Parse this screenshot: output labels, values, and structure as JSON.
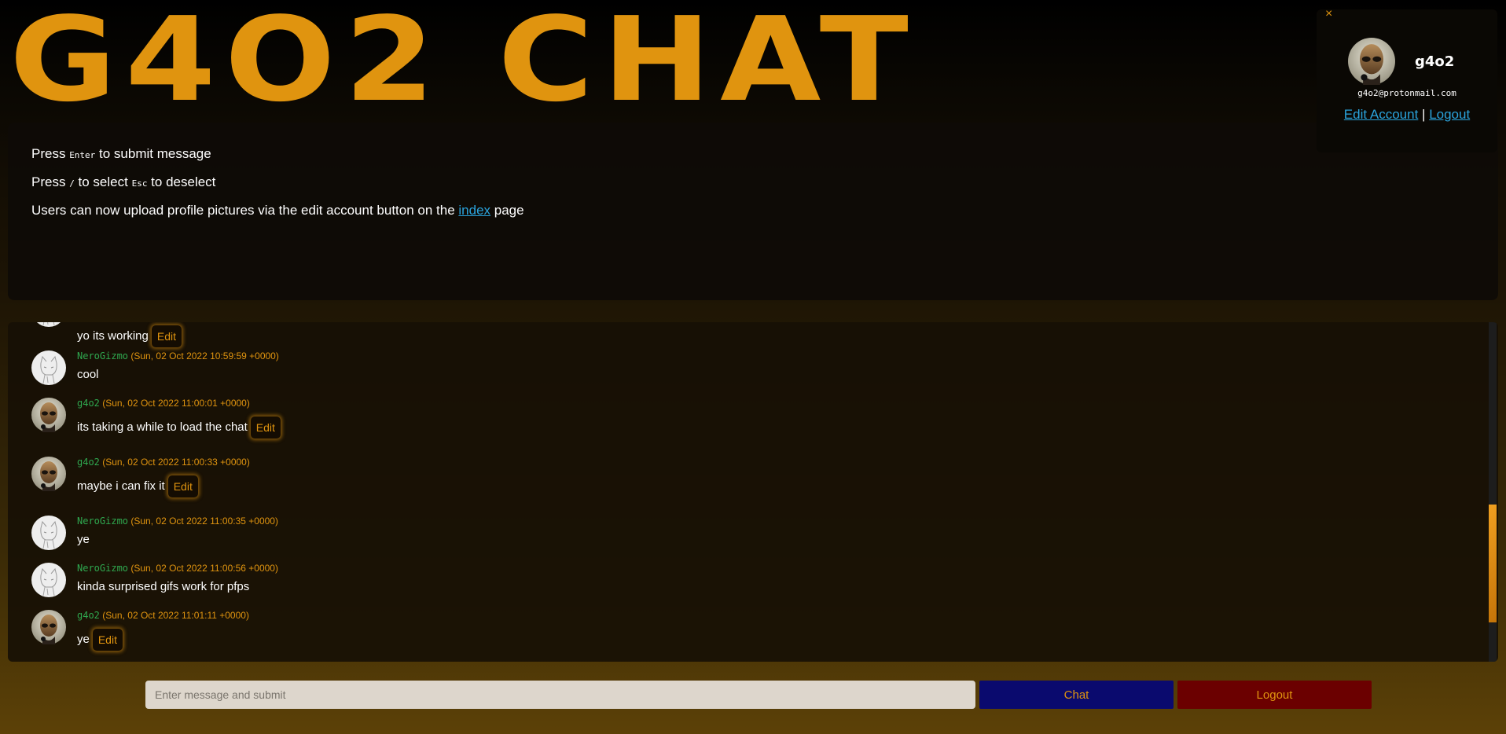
{
  "header": {
    "title": "G4O2 CHAT"
  },
  "info": {
    "line1": {
      "before": "Press ",
      "key": "Enter",
      "after": " to submit message"
    },
    "line2": {
      "before": "Press ",
      "key1": "/",
      "middle": " to select ",
      "key2": "Esc",
      "after": " to deselect"
    },
    "line3": {
      "before": "Users can now upload profile pictures via the edit account button on the ",
      "link": "index",
      "after": " page"
    }
  },
  "user_card": {
    "close_icon": "×",
    "username": "g4o2",
    "email": "g4o2@protonmail.com",
    "edit_account": "Edit Account",
    "separator": " | ",
    "logout": "Logout",
    "avatar_icon": "alien-avatar-icon"
  },
  "messages": [
    {
      "author": "",
      "time": "",
      "text": "yo its working",
      "editable": true,
      "avatar": "cat-avatar-icon"
    },
    {
      "author": "NeroGizmo",
      "time": "(Sun, 02 Oct 2022 10:59:59 +0000)",
      "text": "cool",
      "editable": false,
      "avatar": "cat-avatar-icon"
    },
    {
      "author": "g4o2",
      "time": "(Sun, 02 Oct 2022 11:00:01 +0000)",
      "text": "its taking a while to load the chat",
      "editable": true,
      "avatar": "alien-avatar-icon"
    },
    {
      "author": "g4o2",
      "time": "(Sun, 02 Oct 2022 11:00:33 +0000)",
      "text": "maybe i can fix it",
      "editable": true,
      "avatar": "alien-avatar-icon"
    },
    {
      "author": "NeroGizmo",
      "time": "(Sun, 02 Oct 2022 11:00:35 +0000)",
      "text": "ye",
      "editable": false,
      "avatar": "cat-avatar-icon"
    },
    {
      "author": "NeroGizmo",
      "time": "(Sun, 02 Oct 2022 11:00:56 +0000)",
      "text": "kinda surprised gifs work for pfps",
      "editable": false,
      "avatar": "cat-avatar-icon"
    },
    {
      "author": "g4o2",
      "time": "(Sun, 02 Oct 2022 11:01:11 +0000)",
      "text": "ye",
      "editable": true,
      "avatar": "alien-avatar-icon"
    }
  ],
  "edit_label": "Edit",
  "composer": {
    "placeholder": "Enter message and submit",
    "value": "",
    "chat_label": "Chat",
    "logout_label": "Logout"
  },
  "colors": {
    "accent": "#e0940f",
    "author": "#2fa84f",
    "link": "#2aa3dc",
    "chat_button": "#0a0a6e",
    "logout_button": "#6b0000",
    "input_bg": "#ddd6cc"
  }
}
